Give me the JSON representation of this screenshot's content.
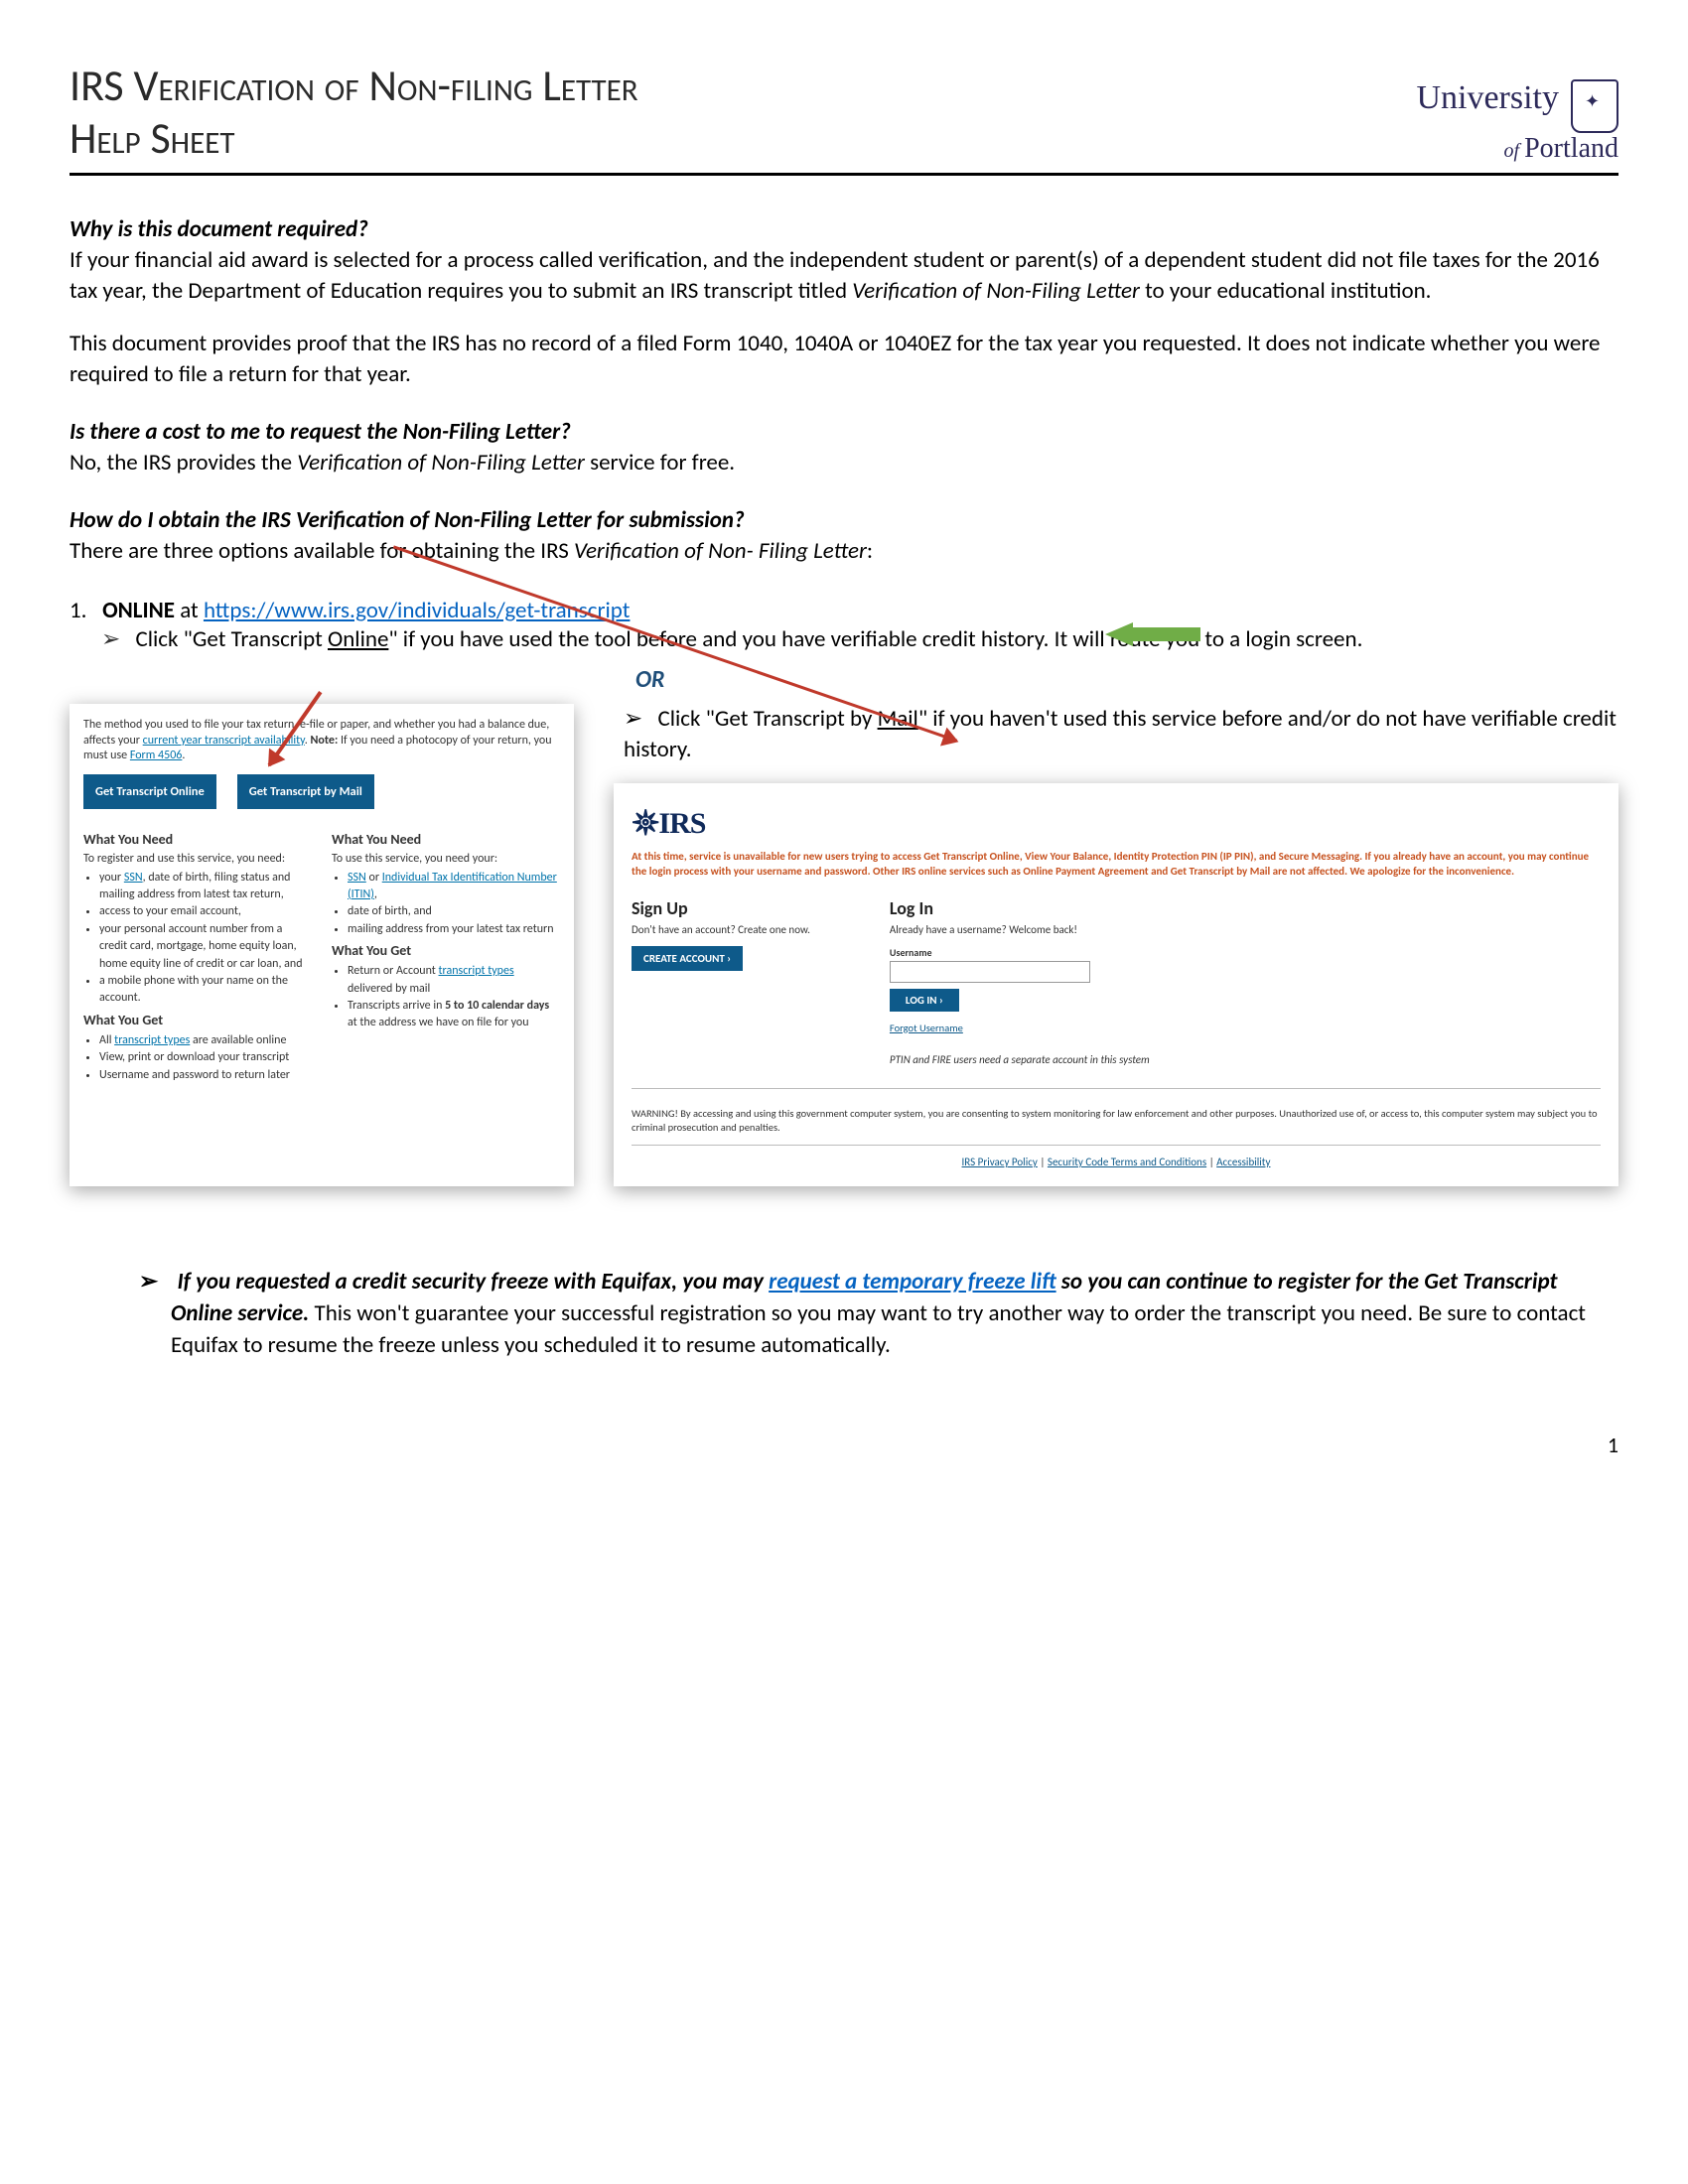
{
  "header": {
    "title_line1": "IRS Verification of Non-filing Letter",
    "title_line2": "Help Sheet",
    "logo_main": "University",
    "logo_of": "of ",
    "logo_sub": "Portland"
  },
  "q1": {
    "heading": "Why is this document required?",
    "p1a": "If your financial aid award is selected for a process called verification, and the independent student or parent(s) of a dependent student did not file taxes for the 2016 tax year, the Department of Education requires you to submit an IRS transcript titled ",
    "p1_em": "Verification of Non-Filing Letter",
    "p1b": " to your educational institution.",
    "p2": "This document provides proof that the IRS has no record of a filed Form 1040, 1040A or 1040EZ for the tax year you requested. It does not indicate whether you were required to file a return for that year."
  },
  "q2": {
    "heading": "Is there a cost to me to request the Non-Filing Letter?",
    "p1a": "No, the IRS provides the ",
    "p1_em": "Verification of Non-Filing Letter",
    "p1b": " service for free."
  },
  "q3": {
    "heading": "How do I obtain the IRS Verification of Non-Filing Letter for submission?",
    "p1a": "There are three options available for obtaining the IRS ",
    "p1_em": "Verification of Non- Filing Letter",
    "p1b": ":"
  },
  "step1": {
    "number": "1.",
    "label_bold": "ONLINE",
    "label_rest": " at ",
    "url": "https://www.irs.gov/individuals/get-transcript",
    "bullet1a": "Click \"Get Transcript ",
    "bullet1_u": "Online",
    "bullet1b": "\" if you have used the tool before and you have verifiable credit history. It will route you to a login screen.",
    "or": "OR",
    "bullet2a": "Click \"Get Transcript by ",
    "bullet2_u": "Mail",
    "bullet2b": "\" if you haven't used this service before and/or do not have verifiable credit history."
  },
  "shot1": {
    "intro1": "The method you used to file your tax return, e-file or paper, and whether you had a balance due, affects your ",
    "intro_link1": "current year transcript availability",
    "intro2": ". ",
    "intro_bold": "Note:",
    "intro3": " If you need a photocopy of your return, you must use ",
    "intro_link2": "Form 4506",
    "intro4": ".",
    "btn_online": "Get Transcript Online",
    "btn_mail": "Get Transcript by Mail",
    "colA": {
      "h1": "What You Need",
      "p": "To register and use this service, you need:",
      "items": [
        "your <a>SSN</a>, date of birth, filing status and mailing address from latest tax return,",
        "access to your email account,",
        "your personal account number from a credit card, mortgage, home equity loan, home equity line of credit or car loan, and",
        "a mobile phone with your name on the account."
      ],
      "h2": "What You Get",
      "items2": [
        "All <a>transcript types</a> are available online",
        "View, print or download your transcript",
        "Username and password to return later"
      ]
    },
    "colB": {
      "h1": "What You Need",
      "p": "To use this service, you need your:",
      "items": [
        "<a>SSN</a> or <a>Individual Tax Identification Number (ITIN)</a>,",
        "date of birth, and",
        "mailing address from your latest tax return"
      ],
      "h2": "What You Get",
      "items2": [
        "Return or Account <a>transcript types</a> delivered by mail",
        "Transcripts arrive in <b>5 to 10 calendar days</b> at the address we have on file for you"
      ]
    }
  },
  "shot2": {
    "logo": "IRS",
    "warning": "At this time, service is unavailable for new users trying to access Get Transcript Online, View Your Balance, Identity Protection PIN (IP PIN), and Secure Messaging. If you already have an account, you may continue the login process with your username and password. Other IRS online services such as Online Payment Agreement and Get Transcript by Mail are not affected. We apologize for the inconvenience.",
    "signup": {
      "h": "Sign Up",
      "p": "Don't have an account? Create one now.",
      "btn": "CREATE ACCOUNT  ›"
    },
    "login": {
      "h": "Log In",
      "p": "Already have a username? Welcome back!",
      "label": "Username",
      "btn": "LOG IN  ›",
      "forgot": "Forgot Username"
    },
    "note": "PTIN and FIRE users need a separate account in this system",
    "warning2": "WARNING! By accessing and using this government computer system, you are consenting to system monitoring for law enforcement and other purposes. Unauthorized use of, or access to, this computer system may subject you to criminal prosecution and penalties.",
    "links": {
      "l1": "IRS Privacy Policy",
      "l2": "Security Code Terms and Conditions",
      "l3": "Accessibility"
    }
  },
  "final": {
    "b1": "If you requested a credit security freeze with Equifax, you may ",
    "link": "request a temporary freeze lift",
    "b2": " so you can continue to register for the Get Transcript Online service.",
    "rest": " This won't guarantee your successful registration so you may want to try another way to order the transcript you need. Be sure to contact Equifax to resume the freeze unless you scheduled it to resume automatically."
  },
  "pagenum": "1"
}
